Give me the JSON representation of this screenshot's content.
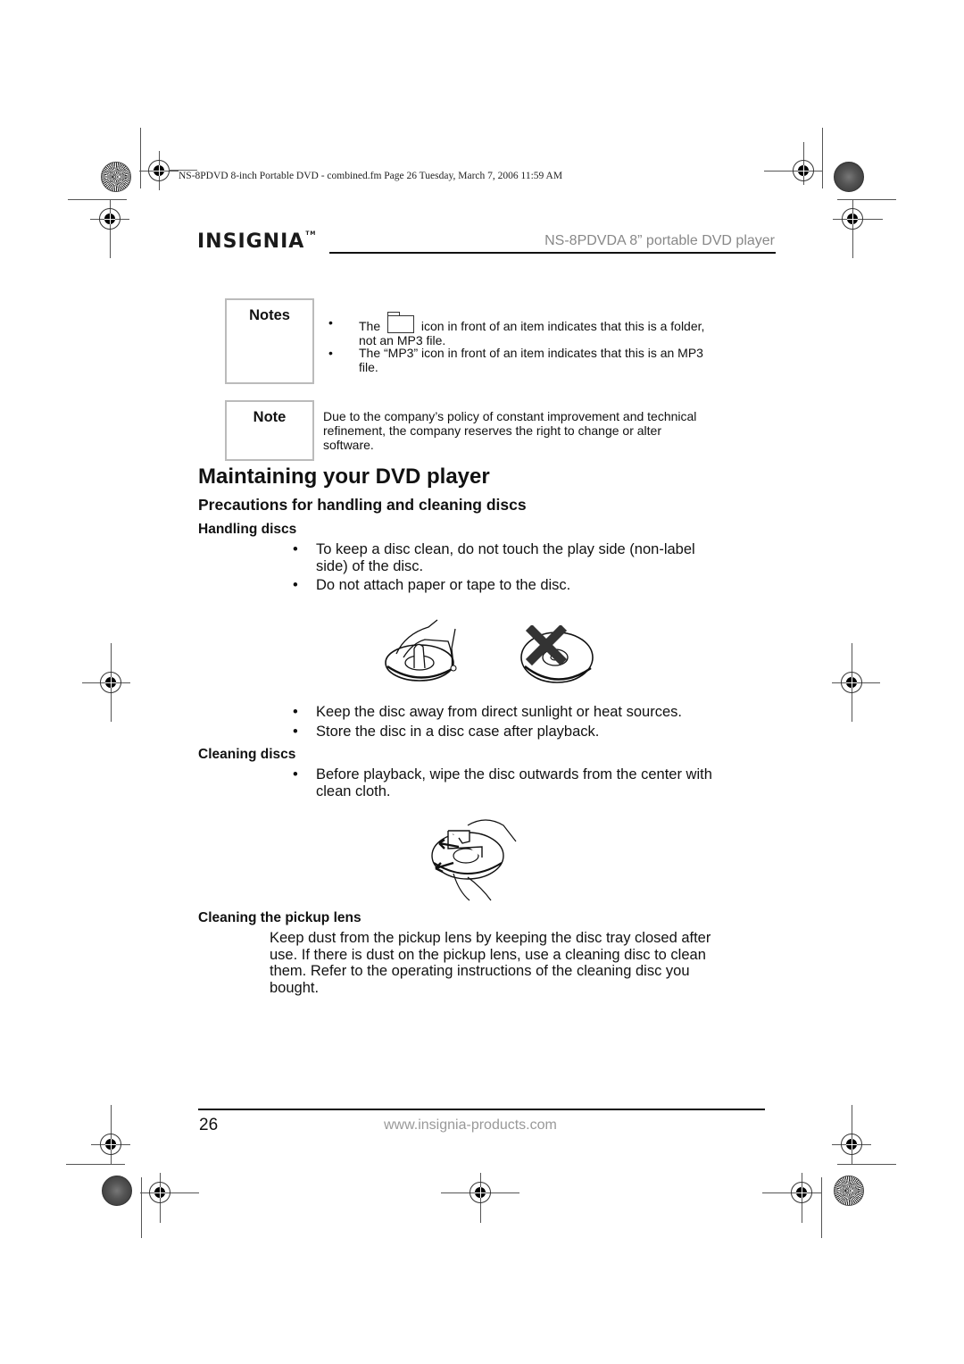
{
  "framemaker_header": "NS-8PDVD 8-inch Portable DVD - combined.fm  Page 26  Tuesday, March 7, 2006  11:59 AM",
  "header": {
    "logo_text": "INSIGNIA",
    "logo_tm": "TM",
    "product_title": "NS-8PDVDA 8” portable DVD player"
  },
  "notes_box": {
    "label": "Notes",
    "items": [
      {
        "before_icon": "The",
        "icon": "folder-icon",
        "after_icon": "icon in front of an item indicates that this is a folder,",
        "line2": "not an MP3 file."
      },
      {
        "text_line1": "The “MP3” icon in front of an item indicates that this is an MP3",
        "text_line2": "file."
      }
    ]
  },
  "note_box": {
    "label": "Note",
    "lines": [
      "Due to the company’s policy of constant improvement and technical",
      "refinement, the company reserves the right to change or alter",
      "software."
    ]
  },
  "section": {
    "title": "Maintaining your DVD player",
    "subtitle": "Precautions for handling and cleaning discs",
    "handling": {
      "heading": "Handling discs",
      "bullets_top": [
        {
          "line1": "To keep a disc clean, do not touch the play side (non-label",
          "line2": "side) of the disc."
        },
        {
          "line1": "Do not attach paper or tape to the disc."
        }
      ],
      "illustrations": [
        "hand-holding-disc-edge",
        "disc-with-tape-crossed-out"
      ],
      "bullets_bottom": [
        "Keep the disc away from direct sunlight or heat sources.",
        "Store the disc in a disc case after playback."
      ]
    },
    "cleaning": {
      "heading": "Cleaning discs",
      "bullet_line1": "Before playback, wipe the disc outwards from the center with",
      "bullet_line2": "clean cloth.",
      "illustration": "wiping-disc-outwards"
    },
    "pickup": {
      "heading": "Cleaning the pickup lens",
      "lines": [
        "Keep dust from the pickup lens by keeping the disc tray closed after",
        "use. If there is dust on the pickup lens, use a cleaning disc to clean",
        "them. Refer to the operating instructions of the cleaning disc you",
        "bought."
      ]
    }
  },
  "footer": {
    "page_number": "26",
    "url": "www.insignia-products.com"
  },
  "bullet_char": "•"
}
